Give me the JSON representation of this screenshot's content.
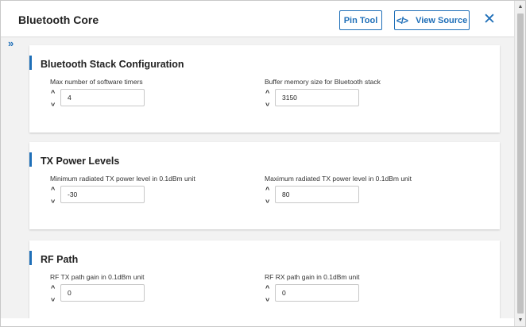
{
  "header": {
    "title": "Bluetooth Core",
    "pin_tool_label": "Pin Tool",
    "view_source_label": "View Source",
    "view_source_icon": "</>",
    "close_icon": "✕"
  },
  "sidebar": {
    "expand_icon": "»"
  },
  "stepper": {
    "up": "^",
    "down": "^"
  },
  "sections": [
    {
      "title": "Bluetooth Stack Configuration",
      "fields": [
        {
          "label": "Max number of software timers",
          "value": "4"
        },
        {
          "label": "Buffer memory size for Bluetooth stack",
          "value": "3150"
        }
      ]
    },
    {
      "title": "TX Power Levels",
      "fields": [
        {
          "label": "Minimum radiated TX power level in 0.1dBm unit",
          "value": "-30"
        },
        {
          "label": "Maximum radiated TX power level in 0.1dBm unit",
          "value": "80"
        }
      ]
    },
    {
      "title": "RF Path",
      "fields": [
        {
          "label": "RF TX path gain in 0.1dBm unit",
          "value": "0"
        },
        {
          "label": "RF RX path gain in 0.1dBm unit",
          "value": "0"
        }
      ]
    }
  ],
  "scrollbar": {
    "up_icon": "▲",
    "down_icon": "▼"
  },
  "colors": {
    "accent": "#1f6fb8",
    "background": "#f2f2f2"
  }
}
